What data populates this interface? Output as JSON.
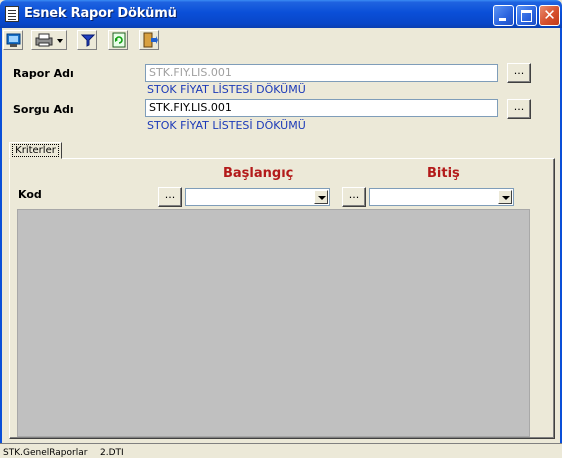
{
  "window": {
    "title": "Esnek Rapor Dökümü",
    "close_glyph": "✕"
  },
  "toolbar": {
    "buttons": [
      {
        "name": "export-icon"
      },
      {
        "name": "printer-icon"
      },
      {
        "name": "filter-icon"
      },
      {
        "name": "refresh-icon"
      },
      {
        "name": "exit-icon"
      }
    ]
  },
  "form": {
    "rapor": {
      "label": "Rapor Adı",
      "value": "STK.FIY.LIS.001",
      "description": "STOK FİYAT LİSTESİ DÖKÜMÜ",
      "browse": "..."
    },
    "sorgu": {
      "label": "Sorgu Adı",
      "value": "STK.FIY.LIS.001",
      "description": "STOK FİYAT LİSTESİ DÖKÜMÜ",
      "browse": "..."
    }
  },
  "tabs": [
    {
      "label": "Kriterler"
    }
  ],
  "criteria": {
    "start_header": "Başlangıç",
    "end_header": "Bitiş",
    "rows": [
      {
        "label": "Kod",
        "start_browse": "...",
        "start_value": "",
        "end_browse": "...",
        "end_value": ""
      }
    ]
  },
  "status": {
    "left": "STK.GenelRaporlar",
    "right": "2.DTI"
  },
  "colors": {
    "title_bar": "#0a4fd8",
    "header_red": "#b31a1a",
    "desc_blue": "#1c3ab8",
    "grid_gray": "#c0c0c0"
  }
}
